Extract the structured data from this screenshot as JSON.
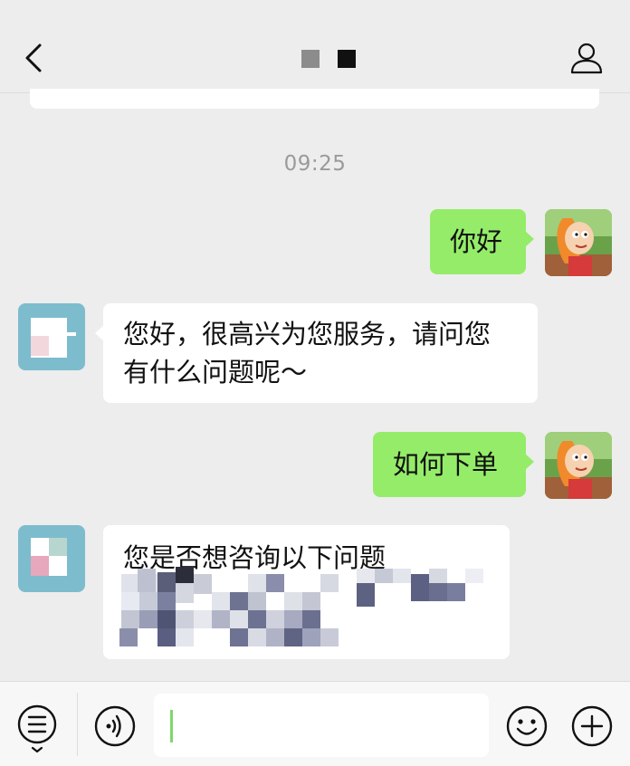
{
  "header": {
    "back_icon": "chevron-left-icon",
    "contact_icon": "user-icon"
  },
  "chat": {
    "timestamp": "09:25",
    "messages": [
      {
        "from": "me",
        "text": "你好"
      },
      {
        "from": "them",
        "lines": [
          "您好，很高兴为您服务，请问您",
          "有什么问题呢～"
        ]
      },
      {
        "from": "me",
        "text": "如何下单"
      },
      {
        "from": "them",
        "text": "您是否想咨询以下问题"
      }
    ]
  },
  "bottom_bar": {
    "menu_icon": "list-menu-icon",
    "voice_icon": "voice-icon",
    "emoji_icon": "smiley-icon",
    "add_icon": "plus-icon"
  },
  "colors": {
    "me_bubble": "#95ec69",
    "them_bubble": "#ffffff",
    "background": "#ededed",
    "timestamp": "#9a9a9a"
  }
}
